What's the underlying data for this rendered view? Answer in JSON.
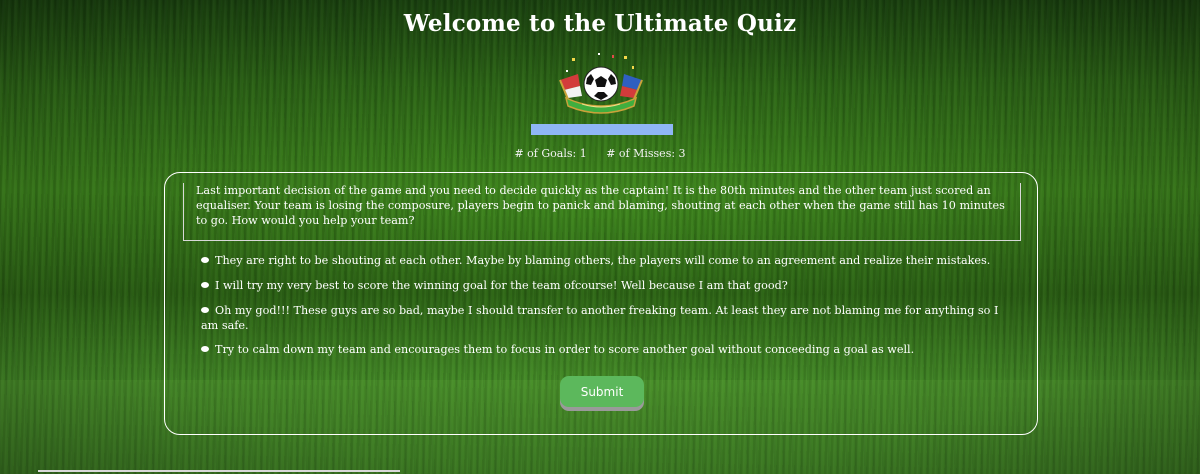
{
  "page": {
    "title": "Welcome to the Ultimate Quiz"
  },
  "logo": {
    "icon": "soccer-ball-trophy-icon"
  },
  "progress": {
    "fraction": 1.0,
    "color": "#8fb6f5"
  },
  "score": {
    "goals_label": "# of Goals: 1",
    "misses_label": "# of Misses: 3"
  },
  "question": {
    "text": "Last important decision of the game and you need to decide quickly as the captain! It is the 80th minutes and the other team just scored an equaliser. Your team is losing the composure, players begin to panick and blaming, shouting at each other when the game still has 10 minutes to go. How would you help your team?"
  },
  "answers": [
    {
      "label": "They are right to be shouting at each other. Maybe by blaming others, the players will come to an agreement and realize their mistakes."
    },
    {
      "label": "I will try my very best to score the winning goal for the team ofcourse! Well because I am that good?"
    },
    {
      "label": "Oh my god!!! These guys are so bad, maybe I should transfer to another freaking team. At least they are not blaming me for anything so I am safe."
    },
    {
      "label": "Try to calm down my team and encourages them to focus in order to score another goal without conceeding a goal as well."
    }
  ],
  "submit": {
    "label": "Submit",
    "color": "#5cb85c"
  }
}
